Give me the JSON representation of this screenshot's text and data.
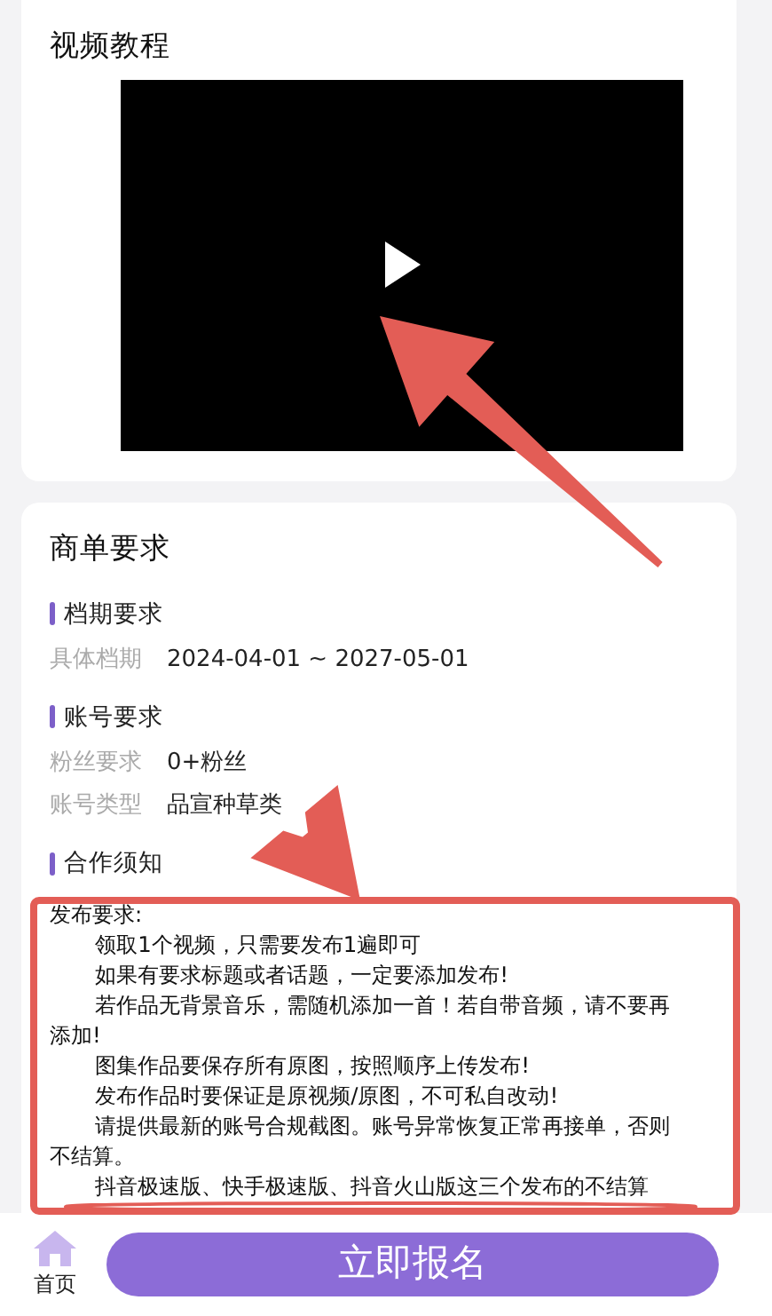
{
  "video_section": {
    "title": "视频教程"
  },
  "requirements": {
    "title": "商单要求",
    "sections": [
      {
        "heading": "档期要求",
        "fields": [
          {
            "label": "具体档期",
            "value": "2024-04-01 ~ 2027-05-01"
          }
        ]
      },
      {
        "heading": "账号要求",
        "fields": [
          {
            "label": "粉丝要求",
            "value": "0+粉丝"
          },
          {
            "label": "账号类型",
            "value": "品宣种草类"
          }
        ]
      },
      {
        "heading": "合作须知",
        "notes": [
          {
            "text": "发布要求:",
            "indent": false
          },
          {
            "text": "领取1个视频，只需要发布1遍即可",
            "indent": true
          },
          {
            "text": "如果有要求标题或者话题，一定要添加发布!",
            "indent": true
          },
          {
            "text": "若作品无背景音乐，需随机添加一首！若自带音频，请不要再",
            "indent": true
          },
          {
            "text": "添加!",
            "indent": false
          },
          {
            "text": "图集作品要保存所有原图，按照顺序上传发布!",
            "indent": true
          },
          {
            "text": "发布作品时要保证是原视频/原图，不可私自改动!",
            "indent": true
          },
          {
            "text": "请提供最新的账号合规截图。账号异常恢复正常再接单，否则",
            "indent": true
          },
          {
            "text": "不结算。",
            "indent": false
          },
          {
            "text": "抖音极速版、快手极速版、抖音火山版这三个发布的不结算",
            "indent": true
          }
        ]
      }
    ]
  },
  "bottom_bar": {
    "home_label": "首页",
    "signup_button": "立即报名"
  }
}
